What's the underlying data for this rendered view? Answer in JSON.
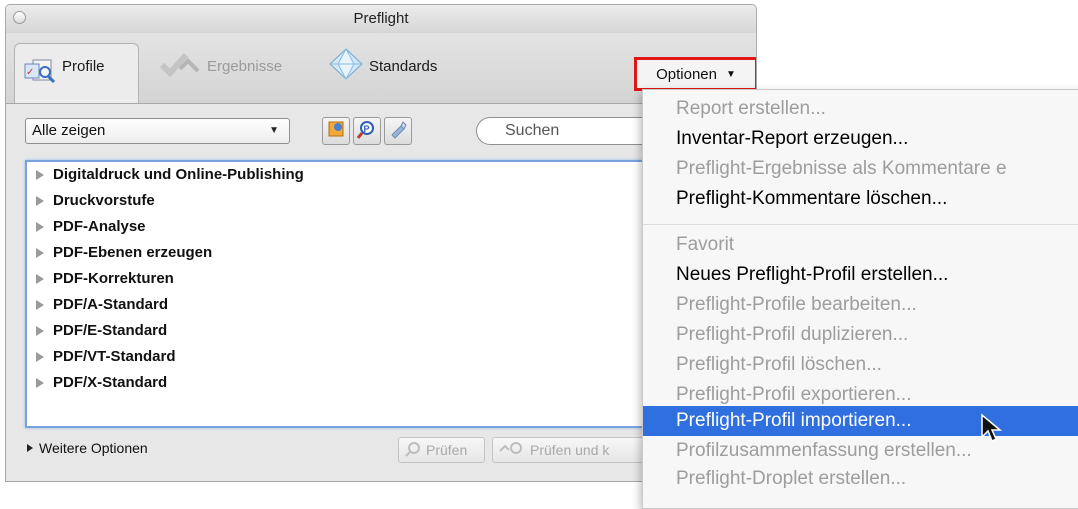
{
  "window": {
    "title": "Preflight"
  },
  "tabs": [
    {
      "label": "Profile",
      "icon": "profile-icon",
      "state": "active"
    },
    {
      "label": "Ergebnisse",
      "icon": "results-checkmark-icon",
      "state": "disabled"
    },
    {
      "label": "Standards",
      "icon": "standards-diamond-icon",
      "state": "normal"
    }
  ],
  "options_button": {
    "label": "Optionen",
    "highlight_color": "#e01616"
  },
  "filter": {
    "selected": "Alle zeigen"
  },
  "toolbar_icons": [
    "select-profile-icon",
    "fixup-icon",
    "edit-icon"
  ],
  "search": {
    "placeholder": "Suchen"
  },
  "profile_groups": [
    "Digitaldruck und Online-Publishing",
    "Druckvorstufe",
    "PDF-Analyse",
    "PDF-Ebenen erzeugen",
    "PDF-Korrekturen",
    "PDF/A-Standard",
    "PDF/E-Standard",
    "PDF/VT-Standard",
    "PDF/X-Standard"
  ],
  "more_options": "Weitere Optionen",
  "bottom_buttons": {
    "check": "Prüfen",
    "check_and_fix": "Prüfen und k"
  },
  "menu": {
    "items": [
      {
        "label": "Report erstellen...",
        "state": "disabled"
      },
      {
        "label": "Inventar-Report erzeugen...",
        "state": "enabled"
      },
      {
        "label": "Preflight-Ergebnisse als Kommentare e",
        "state": "disabled"
      },
      {
        "label": "Preflight-Kommentare löschen...",
        "state": "enabled"
      },
      {
        "label": "Favorit",
        "state": "disabled"
      },
      {
        "label": "Neues Preflight-Profil erstellen...",
        "state": "enabled"
      },
      {
        "label": "Preflight-Profile bearbeiten...",
        "state": "disabled"
      },
      {
        "label": "Preflight-Profil duplizieren...",
        "state": "disabled"
      },
      {
        "label": "Preflight-Profil löschen...",
        "state": "disabled"
      },
      {
        "label": "Preflight-Profil exportieren...",
        "state": "disabled"
      },
      {
        "label": "Preflight-Profil importieren...",
        "state": "selected"
      },
      {
        "label": "Profilzusammenfassung erstellen...",
        "state": "disabled"
      },
      {
        "label": "Preflight-Droplet erstellen...",
        "state": "disabled"
      }
    ],
    "selected_color": "#2f6fe0"
  }
}
